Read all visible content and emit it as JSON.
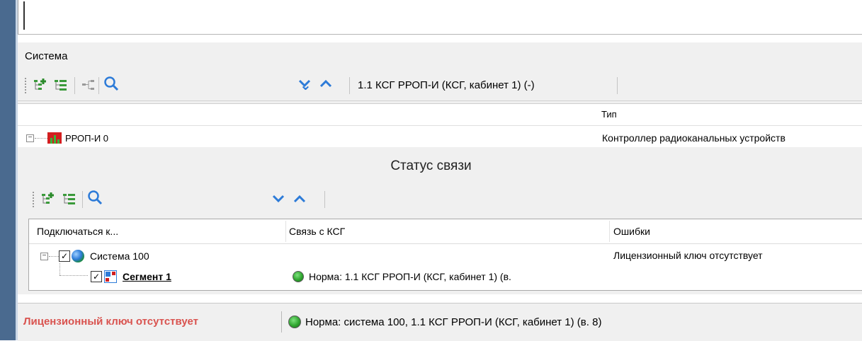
{
  "system_panel": {
    "title": "Система",
    "path_label": "1.1 КСГ РРОП-И (КСГ, кабинет 1) (-)",
    "columns": {
      "type": "Тип"
    },
    "rows": [
      {
        "name": "РРОП-И 0",
        "type": "Контроллер радиоканальных устройств"
      }
    ]
  },
  "status_dialog": {
    "title": "Статус связи",
    "columns": {
      "connect_to": "Подключаться к...",
      "link": "Связь с КСГ",
      "errors": "Ошибки"
    },
    "rows": [
      {
        "name": "Система 100",
        "checked": true,
        "link": "",
        "errors": "Лицензионный ключ отсутствует",
        "icon": "globe-icon"
      },
      {
        "name": "Сегмент 1",
        "checked": true,
        "link": "Норма: 1.1 КСГ РРОП-И (КСГ, кабинет 1) (в.",
        "errors": "",
        "icon": "segment-icon",
        "link_status": "green"
      }
    ]
  },
  "status_bar": {
    "error_text": "Лицензионный ключ отсутствует",
    "status_text": "Норма:  система 100, 1.1 КСГ РРОП-И (КСГ, кабинет 1) (в. 8)"
  },
  "colors": {
    "error_red": "#d9534f",
    "accent_blue": "#2d7bd8",
    "status_green": "#2fa52f"
  }
}
